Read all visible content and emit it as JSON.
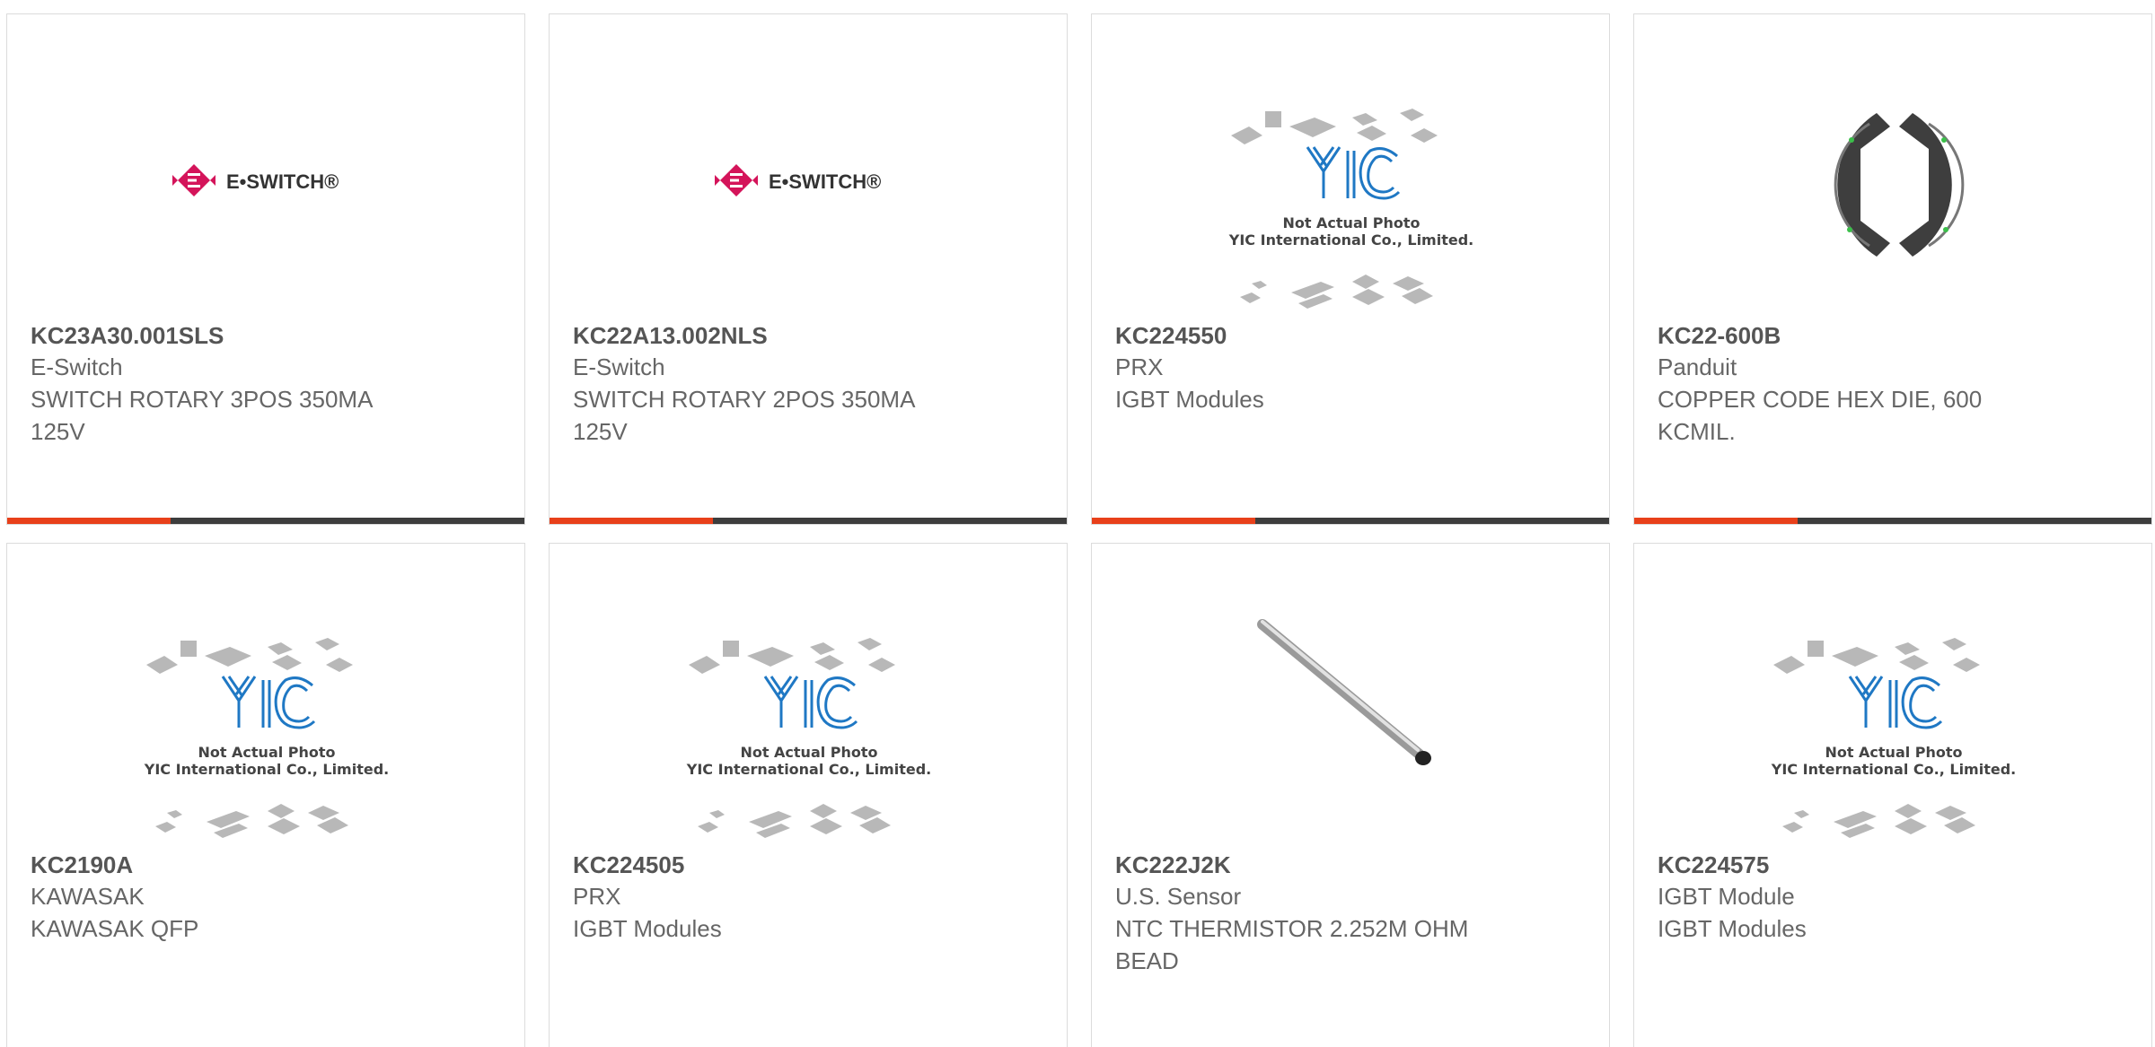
{
  "colors": {
    "accent": "#e8401a",
    "bar": "#3d3d3d",
    "eswitch_brand": "#d4145a",
    "yic_blue": "#1f78c4"
  },
  "placeholder": {
    "logo_text": "YIC",
    "line1": "Not Actual Photo",
    "line2": "YIC International Co., Limited."
  },
  "eswitch_logo": {
    "text": "E•SWITCH®"
  },
  "products": [
    {
      "part_number": "KC23A30.001SLS",
      "manufacturer": "E-Switch",
      "description": "SWITCH ROTARY 3POS 350MA 125V",
      "image_icon": "e-switch-logo"
    },
    {
      "part_number": "KC22A13.002NLS",
      "manufacturer": "E-Switch",
      "description": "SWITCH ROTARY 2POS 350MA 125V",
      "image_icon": "e-switch-logo"
    },
    {
      "part_number": "KC224550",
      "manufacturer": "PRX",
      "description": "IGBT Modules",
      "image_icon": "yic-not-actual-photo"
    },
    {
      "part_number": "KC22-600B",
      "manufacturer": "Panduit",
      "description": "COPPER CODE HEX DIE, 600 KCMIL.",
      "image_icon": "hex-die-photo"
    },
    {
      "part_number": "KC2190A",
      "manufacturer": "KAWASAK",
      "description": "KAWASAK QFP",
      "image_icon": "yic-not-actual-photo"
    },
    {
      "part_number": "KC224505",
      "manufacturer": "PRX",
      "description": "IGBT Modules",
      "image_icon": "yic-not-actual-photo"
    },
    {
      "part_number": "KC222J2K",
      "manufacturer": "U.S. Sensor",
      "description": "NTC THERMISTOR 2.252M OHM BEAD",
      "image_icon": "thermistor-probe-photo"
    },
    {
      "part_number": "KC224575",
      "manufacturer": "IGBT Module",
      "description": "IGBT Modules",
      "image_icon": "yic-not-actual-photo"
    }
  ]
}
